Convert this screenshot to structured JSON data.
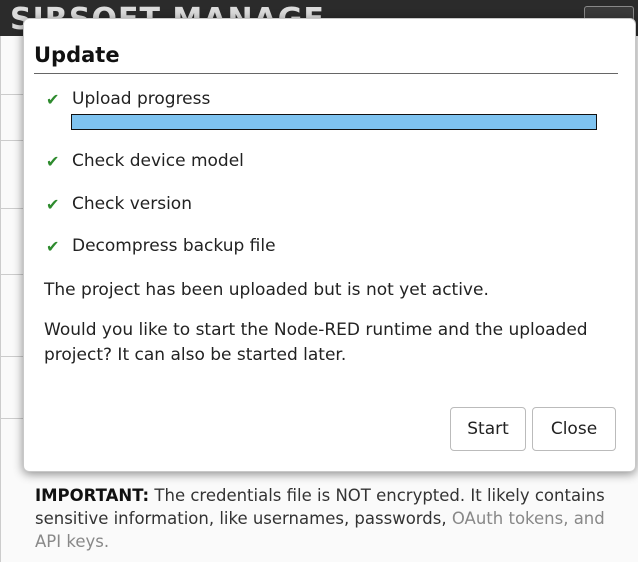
{
  "app": {
    "logo_text": "SIRSOFT MANAGE"
  },
  "dialog": {
    "title": "Update",
    "steps": [
      {
        "label": "Upload progress",
        "icon": "check-icon"
      },
      {
        "label": "Check device model",
        "icon": "check-icon"
      },
      {
        "label": "Check version",
        "icon": "check-icon"
      },
      {
        "label": "Decompress backup file",
        "icon": "check-icon"
      }
    ],
    "upload_progress": 1.0,
    "progress_color": "#7ec3f0",
    "check_color": "#2e8b2e",
    "message_1": "The project has been uploaded but is not yet active.",
    "message_2": "Would you like to start the Node-RED runtime and the uploaded project? It can also be started later.",
    "start_label": "Start",
    "close_label": "Close"
  },
  "background": {
    "important_label": "IMPORTANT:",
    "important_text": " The credentials file is NOT encrypted. It likely contains sensitive information, like usernames, passwords, ",
    "important_text_faded": "OAuth tokens, and API keys."
  }
}
